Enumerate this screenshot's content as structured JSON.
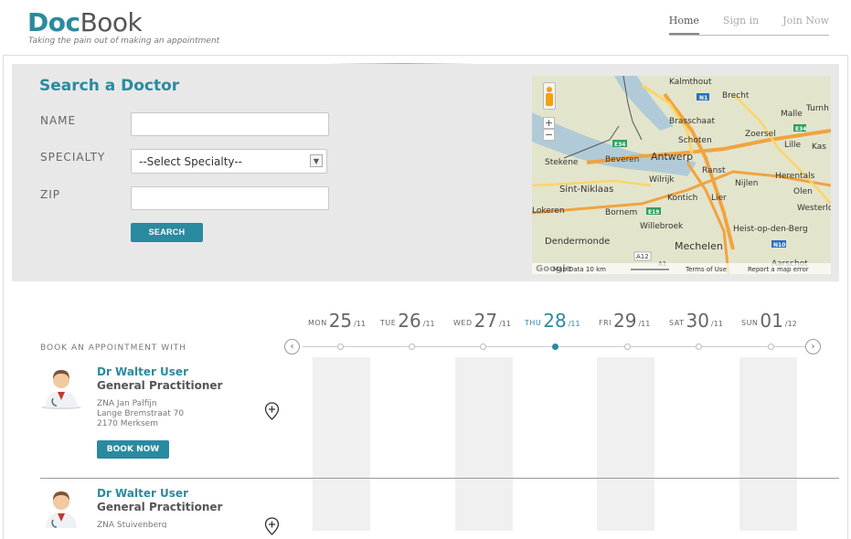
{
  "brand": {
    "doc": "Doc",
    "book": "Book",
    "tagline": "Taking the pain out of making an appointment"
  },
  "nav": [
    {
      "label": "Home",
      "active": true
    },
    {
      "label": "Sign in"
    },
    {
      "label": "Join Now"
    }
  ],
  "search": {
    "title": "Search a Doctor",
    "name_label": "NAME",
    "name_value": "",
    "specialty_label": "SPECIALTY",
    "specialty_value": "--Select Specialty--",
    "zip_label": "ZIP",
    "zip_value": "",
    "button": "SEARCH"
  },
  "map": {
    "places": [
      "Kalmthout",
      "Brecht",
      "Malle",
      "Brasschaat",
      "Zoersel",
      "Schoten",
      "Lille",
      "Kas",
      "Stekene",
      "Beveren",
      "Antwerp",
      "Ranst",
      "Herentals",
      "Wilrijk",
      "Nijlen",
      "Olen",
      "Sint-Niklaas",
      "Kontich",
      "Lier",
      "Westerlo",
      "Lokeren",
      "Bornem",
      "Willebroek",
      "Heist-op-den-Berg",
      "Dendermonde",
      "Mechelen",
      "Aarschot",
      "Turnh"
    ],
    "road_labels": [
      "N1",
      "E34",
      "E34",
      "E19",
      "N10",
      "A12",
      "A1"
    ],
    "zoom_in": "+",
    "zoom_out": "−",
    "footer": "Map Data  10 km",
    "terms": "Terms of Use",
    "report": "Report a map error",
    "google": "Google"
  },
  "booking": {
    "header": "BOOK AN APPOINTMENT WITH",
    "days": [
      {
        "dow": "MON",
        "day": "25",
        "month": "/11"
      },
      {
        "dow": "TUE",
        "day": "26",
        "month": "/11"
      },
      {
        "dow": "WED",
        "day": "27",
        "month": "/11"
      },
      {
        "dow": "THU",
        "day": "28",
        "month": "/11",
        "selected": true
      },
      {
        "dow": "FRI",
        "day": "29",
        "month": "/11"
      },
      {
        "dow": "SAT",
        "day": "30",
        "month": "/11"
      },
      {
        "dow": "SUN",
        "day": "01",
        "month": "/12"
      }
    ],
    "prev": "‹",
    "next": "›"
  },
  "doctors": [
    {
      "name": "Dr Walter User",
      "specialty": "General Practitioner",
      "addr1": "ZNA Jan Palfijn",
      "addr2": "Lange Bremstraat 70",
      "addr3": "2170 Merksem",
      "book": "BOOK NOW"
    },
    {
      "name": "Dr Walter User",
      "specialty": "General Practitioner",
      "addr1": "ZNA Stuivenberg"
    }
  ],
  "colors": {
    "accent": "#2a8aa0",
    "panel": "#e8e8e8"
  }
}
